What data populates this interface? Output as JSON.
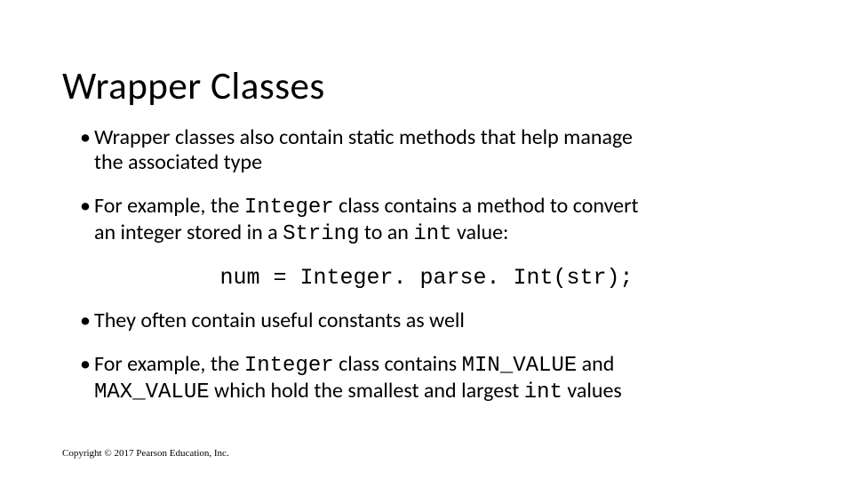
{
  "slide": {
    "title": "Wrapper Classes",
    "bullets": {
      "b1": "Wrapper classes also contain static methods that help manage the associated type",
      "b2_pre": "For example, the ",
      "b2_code1": "Integer",
      "b2_mid1": " class contains a method to convert an integer stored in a ",
      "b2_code2": "String",
      "b2_mid2": " to an ",
      "b2_code3": "int",
      "b2_post": " value:",
      "code_line": "num = Integer. parse. Int(str);",
      "b3": "They often contain useful constants as well",
      "b4_pre": "For example, the ",
      "b4_code1": "Integer",
      "b4_mid1": " class contains ",
      "b4_code2": "MIN_VALUE",
      "b4_mid2": " and ",
      "b4_code3": "MAX_VALUE",
      "b4_mid3": " which hold the smallest and largest ",
      "b4_code4": "int",
      "b4_post": " values"
    },
    "copyright": "Copyright © 2017 Pearson Education, Inc."
  }
}
